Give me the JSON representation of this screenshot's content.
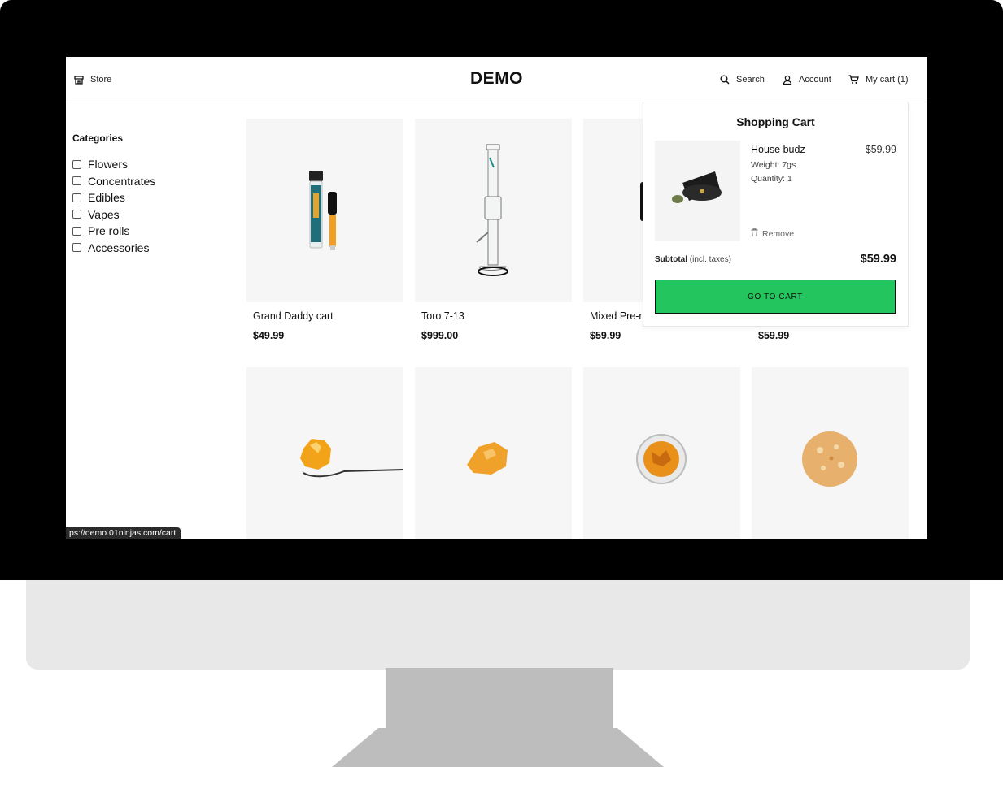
{
  "header": {
    "store_label": "Store",
    "logo": "DEMO",
    "search_label": "Search",
    "account_label": "Account",
    "cart_label": "My cart (1)"
  },
  "sidebar": {
    "title": "Categories",
    "categories": [
      "Flowers",
      "Concentrates",
      "Edibles",
      "Vapes",
      "Pre rolls",
      "Accessories"
    ]
  },
  "products": [
    {
      "name": "Grand Daddy cart",
      "price": "$49.99"
    },
    {
      "name": "Toro 7-13",
      "price": "$999.00"
    },
    {
      "name": "Mixed Pre-r",
      "price": "$59.99"
    },
    {
      "name": "",
      "price": "$59.99"
    },
    {
      "name": "",
      "price": ""
    },
    {
      "name": "",
      "price": ""
    },
    {
      "name": "",
      "price": ""
    },
    {
      "name": "",
      "price": ""
    }
  ],
  "cart": {
    "title": "Shopping Cart",
    "item": {
      "name": "House budz",
      "price": "$59.99",
      "weight": "Weight: 7gs",
      "quantity": "Quantity: 1",
      "remove_label": "Remove"
    },
    "subtotal_label": "Subtotal",
    "subtotal_note": "(incl. taxes)",
    "subtotal_value": "$59.99",
    "button_label": "GO TO CART"
  },
  "status_bar": {
    "url": "ps://demo.01ninjas.com/cart"
  },
  "colors": {
    "accent": "#22c55e",
    "monitor": "#000000",
    "chin": "#e8e8e8",
    "stand": "#bdbdbd"
  }
}
